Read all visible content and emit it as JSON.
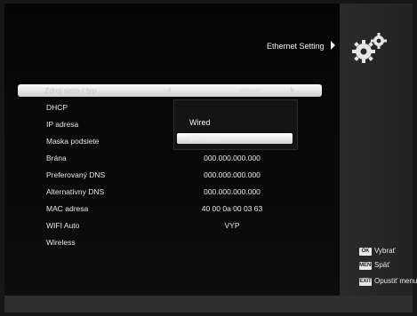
{
  "header": {
    "title": "Ethernet Setting"
  },
  "icons": {
    "settings": "gears-icon"
  },
  "menu": {
    "selected_row": {
      "label": "Zdroj siete / typ",
      "value": "Wired"
    },
    "rows": [
      {
        "label": "DHCP",
        "value": ""
      },
      {
        "label": "IP adresa",
        "value": ""
      },
      {
        "label": "Maska podsiete",
        "value": ""
      },
      {
        "label": "Brána",
        "value": "000.000.000.000"
      },
      {
        "label": "Preferovaný DNS",
        "value": "000.000.000.000"
      },
      {
        "label": "Alternatívny DNS",
        "value": "000.000.000.000"
      },
      {
        "label": "MAC adresa",
        "value": "40 00 0a 00 03 63"
      },
      {
        "label": "WIFI Auto",
        "value": "VYP"
      },
      {
        "label": "Wireless",
        "value": ""
      }
    ]
  },
  "dropdown": {
    "options": [
      "Wired",
      "Wireless"
    ],
    "selected": "Wireless"
  },
  "help": [
    {
      "key": "OK",
      "label": "Vybrať"
    },
    {
      "key": "MENU",
      "label": "Späť"
    },
    {
      "key": "EXIT",
      "label": "Opustiť menu"
    }
  ],
  "colors": {
    "background": "#161616",
    "highlight": "#f0f0f0",
    "text": "#e8e8e8"
  }
}
